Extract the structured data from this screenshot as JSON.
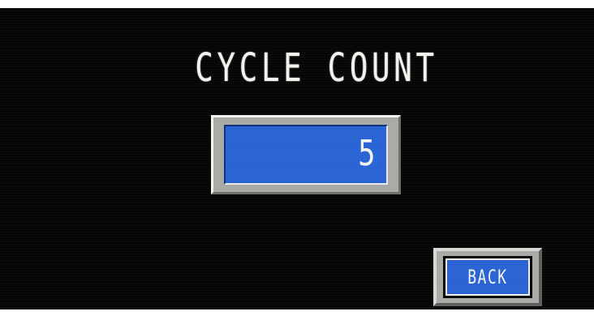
{
  "screen": {
    "title": "CYCLE COUNT",
    "cycle_count_value": "5",
    "back_button_label": "BACK"
  },
  "colors": {
    "background": "#060606",
    "field_blue": "#2a63d4",
    "bezel_gray": "#a9a9a6",
    "text": "#f3f3ee"
  }
}
